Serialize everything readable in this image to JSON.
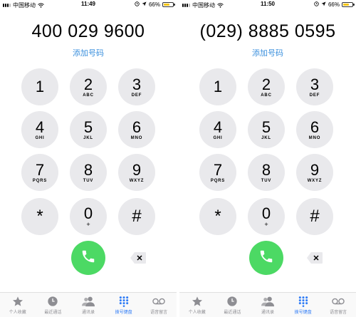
{
  "screens": [
    {
      "status": {
        "carrier": "中国移动",
        "time": "11:49",
        "battery_text": "66%",
        "battery_level": 0.66
      },
      "dialed_number": "400 029 9600",
      "add_number": "添加号码"
    },
    {
      "status": {
        "carrier": "中国移动",
        "time": "11:50",
        "battery_text": "66%",
        "battery_level": 0.66
      },
      "dialed_number": "(029) 8885 0595",
      "add_number": "添加号码"
    }
  ],
  "keypad": [
    {
      "digit": "1",
      "letters": ""
    },
    {
      "digit": "2",
      "letters": "ABC"
    },
    {
      "digit": "3",
      "letters": "DEF"
    },
    {
      "digit": "4",
      "letters": "GHI"
    },
    {
      "digit": "5",
      "letters": "JKL"
    },
    {
      "digit": "6",
      "letters": "MNO"
    },
    {
      "digit": "7",
      "letters": "PQRS"
    },
    {
      "digit": "8",
      "letters": "TUV"
    },
    {
      "digit": "9",
      "letters": "WXYZ"
    },
    {
      "digit": "*",
      "letters": ""
    },
    {
      "digit": "0",
      "letters": "+"
    },
    {
      "digit": "#",
      "letters": ""
    }
  ],
  "tabs": [
    {
      "label": "个人收藏",
      "icon": "star-icon"
    },
    {
      "label": "最近通话",
      "icon": "clock-icon"
    },
    {
      "label": "通讯录",
      "icon": "contacts-icon"
    },
    {
      "label": "拨号键盘",
      "icon": "keypad-icon"
    },
    {
      "label": "语音留言",
      "icon": "voicemail-icon"
    }
  ],
  "active_tab": 3,
  "colors": {
    "accent": "#2f7cf6",
    "call_green": "#4cd964",
    "key_gray": "#e9e9ec",
    "link_blue": "#3a8fdd",
    "battery": "#f5c518"
  }
}
